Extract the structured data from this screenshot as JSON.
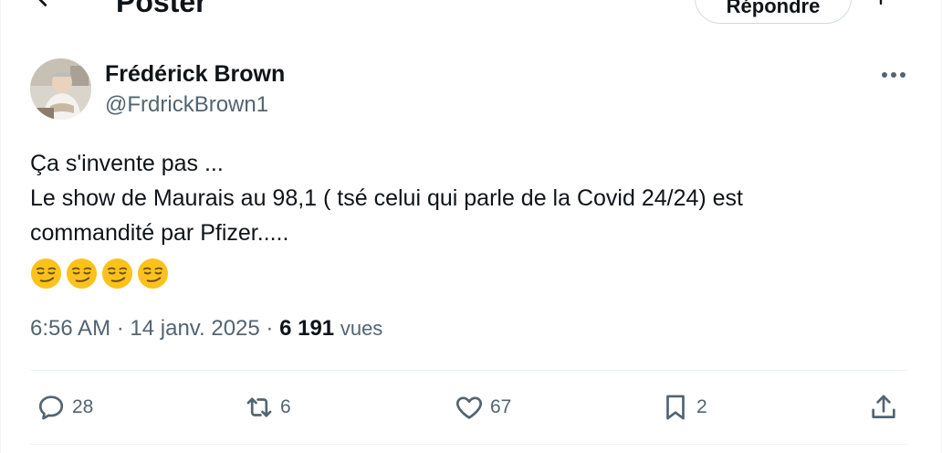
{
  "header": {
    "title": "Poster",
    "reply_label": "Répondre"
  },
  "author": {
    "name": "Frédérick Brown",
    "handle": "@FrdrickBrown1"
  },
  "tweet": {
    "lines": [
      "Ça s'invente pas ...",
      "Le show de Maurais au 98,1 ( tsé celui qui parle de la Covid 24/24) est",
      "commandité par Pfizer....."
    ],
    "emojis": [
      "smirking-face",
      "smirking-face",
      "smirking-face",
      "smirking-face"
    ]
  },
  "meta": {
    "time": "6:56 AM",
    "separator": "·",
    "date": "14 janv. 2025",
    "views_count": "6 191",
    "views_label": "vues"
  },
  "actions": {
    "replies": "28",
    "reposts": "6",
    "likes": "67",
    "bookmarks": "2"
  },
  "colors": {
    "text_primary": "#0f1419",
    "text_secondary": "#536471",
    "border": "#eff3f4"
  }
}
